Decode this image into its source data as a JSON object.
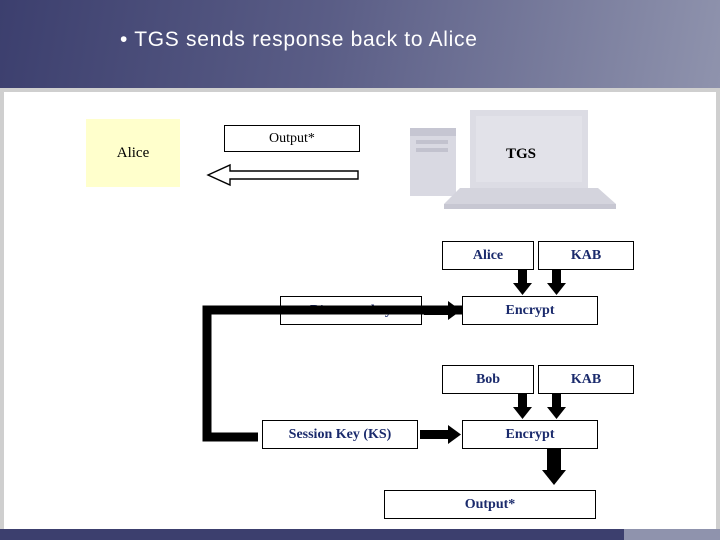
{
  "slide": {
    "title": "• TGS sends response back to Alice",
    "title_bullet": "•"
  },
  "diagram": {
    "nodes": {
      "alice_actor": "Alice",
      "output_top": "Output*",
      "tgs_label": "TGS",
      "alice_box": "Alice",
      "kab_box_1": "KAB",
      "b_secret_key": "B’s secret key",
      "encrypt_1": "Encrypt",
      "bob_box": "Bob",
      "kab_box_2": "KAB",
      "session_key": "Session Key (KS)",
      "encrypt_2": "Encrypt",
      "output_bottom": "Output*"
    },
    "icons": {
      "computer": "computer-icon",
      "response_arrow": "left-arrow-icon"
    },
    "colors": {
      "header_dark": "#3c3f6e",
      "header_light": "#8f93ad",
      "alice_fill": "#ffffcc",
      "body_gray": "#cfcfcf",
      "label_text": "#1a2a6c",
      "monitor_fill": "#dcdce4"
    }
  }
}
